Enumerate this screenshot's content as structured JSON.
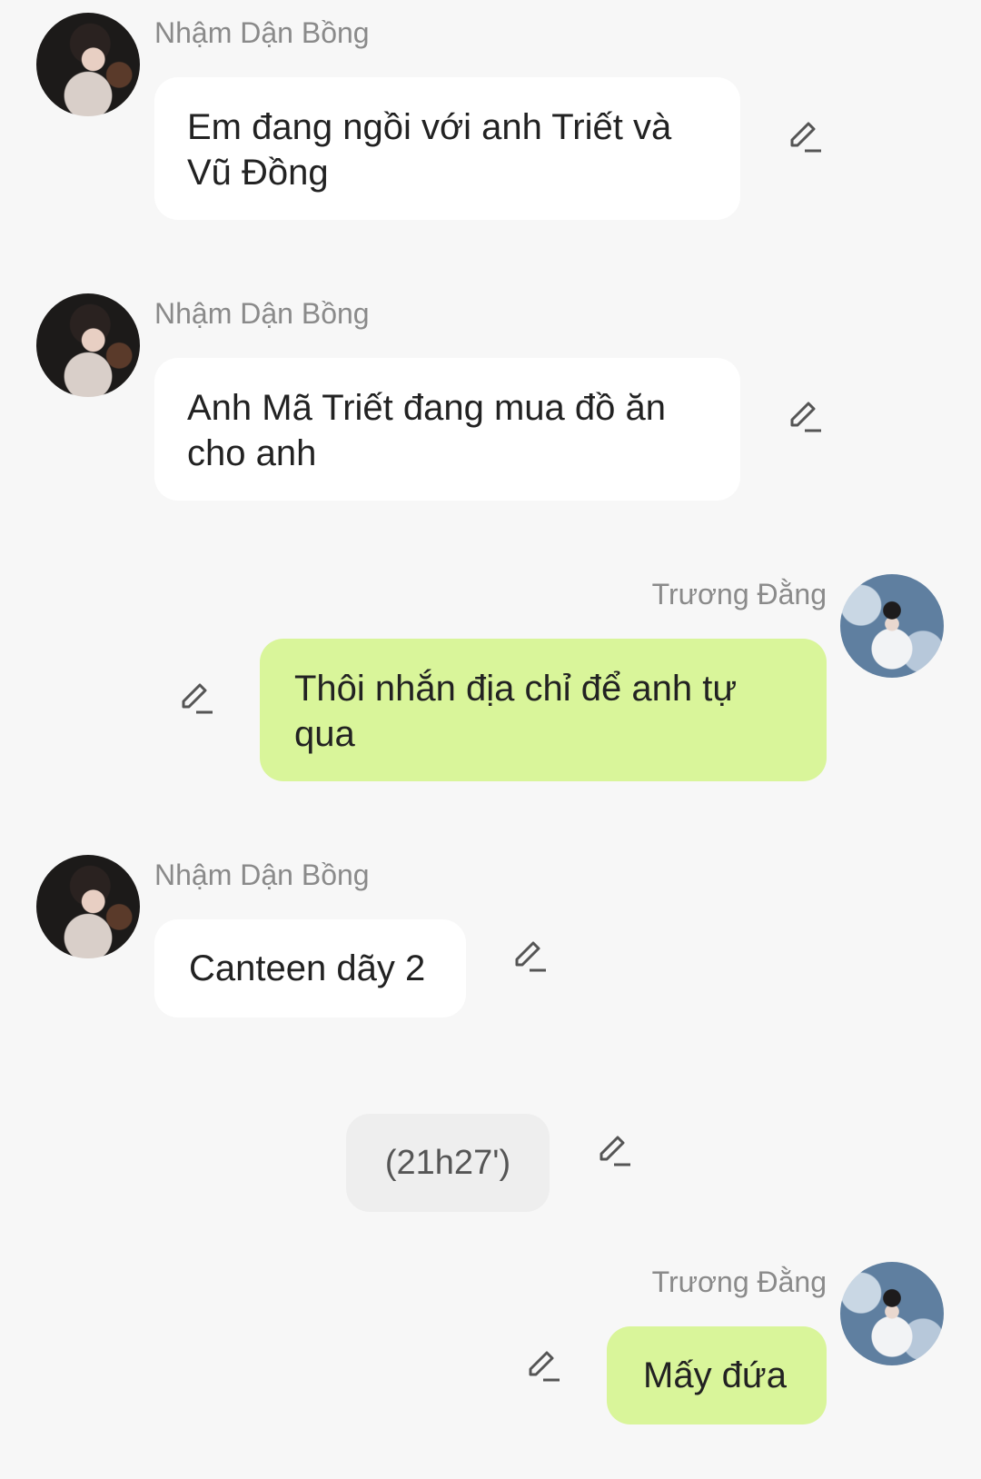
{
  "messages": [
    {
      "sender": "Nhậm Dận Bồng",
      "text": "Em đang ngồi với anh Triết và Vũ Đồng",
      "side": "left"
    },
    {
      "sender": "Nhậm Dận Bồng",
      "text": "Anh Mã Triết đang mua đồ ăn cho anh",
      "side": "left"
    },
    {
      "sender": "Trương Đằng",
      "text": "Thôi nhắn địa chỉ để anh tự qua",
      "side": "right"
    },
    {
      "sender": "Nhậm Dận Bồng",
      "text": "Canteen dãy 2",
      "side": "left"
    },
    {
      "sender": "",
      "text": "(21h27')",
      "side": "center"
    },
    {
      "sender": "Trương Đằng",
      "text": "Mấy đứa",
      "side": "right"
    }
  ],
  "colors": {
    "background": "#f7f7f7",
    "incoming_bubble": "#ffffff",
    "outgoing_bubble": "#d9f59a",
    "system_bubble": "#eeeeee",
    "sender_name": "#8a8a8a"
  },
  "icons": {
    "edit": "pencil-icon"
  }
}
